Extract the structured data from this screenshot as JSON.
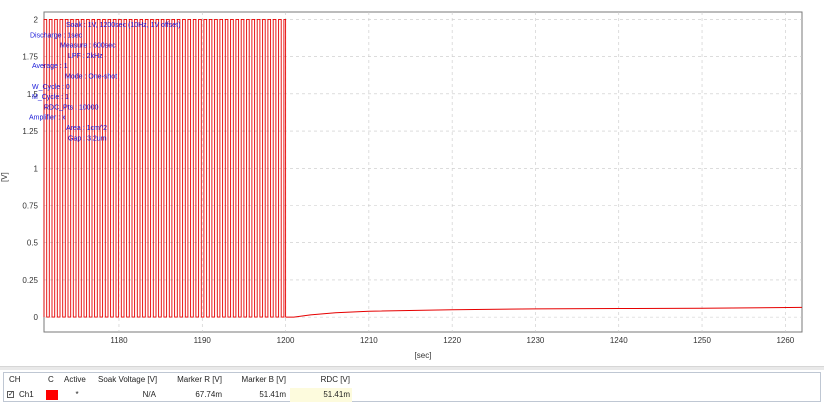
{
  "chart_data": {
    "type": "line",
    "xlabel": "[sec]",
    "ylabel": "[V]",
    "xlim": [
      1171,
      1262
    ],
    "ylim": [
      -0.1,
      2.05
    ],
    "x_ticks": [
      "1180",
      "1190",
      "1200",
      "1210",
      "1220",
      "1230",
      "1240",
      "1250",
      "1260"
    ],
    "y_ticks": [
      "0",
      "0.25",
      "0.5",
      "0.75",
      "1",
      "1.25",
      "1.5",
      "1.75",
      "2"
    ],
    "grid": true,
    "series": [
      {
        "name": "Ch1",
        "color": "#e60000",
        "oscillation": {
          "x_start": 1171,
          "x_end": 1200,
          "period": 0.64,
          "low": 0,
          "high": 2
        },
        "decay_points": [
          [
            1200,
            0.0
          ],
          [
            1201,
            0.0
          ],
          [
            1203,
            0.015
          ],
          [
            1206,
            0.03
          ],
          [
            1210,
            0.04
          ],
          [
            1220,
            0.05
          ],
          [
            1230,
            0.055
          ],
          [
            1240,
            0.058
          ],
          [
            1250,
            0.06
          ],
          [
            1262,
            0.065
          ]
        ]
      }
    ],
    "annotations": [
      "Soak : 1V, 1200sec (10Hz, 1V offset)",
      "Discharge : 1sec",
      "Measure : 600sec",
      "LPF : 2kHz",
      "Average : 1",
      "Mode : One-shot",
      "W_Cycle : 0",
      "M_Cycle : 1",
      "RDC_Pts : 10000",
      "Amplifier : x",
      "Area : 1cm^2",
      "Gap : 3.2um"
    ]
  },
  "table": {
    "headers": {
      "ch": "CH",
      "c": "C",
      "active": "Active",
      "soak": "Soak Voltage [V]",
      "marker_r": "Marker R [V]",
      "marker_b": "Marker B [V]",
      "rdc": "RDC [V]"
    },
    "row": {
      "checked": "✓",
      "ch": "Ch1",
      "color": "#ff0000",
      "active": "*",
      "soak": "N/A",
      "marker_r": "67.74m",
      "marker_b": "51.41m",
      "rdc": "51.41m"
    }
  }
}
